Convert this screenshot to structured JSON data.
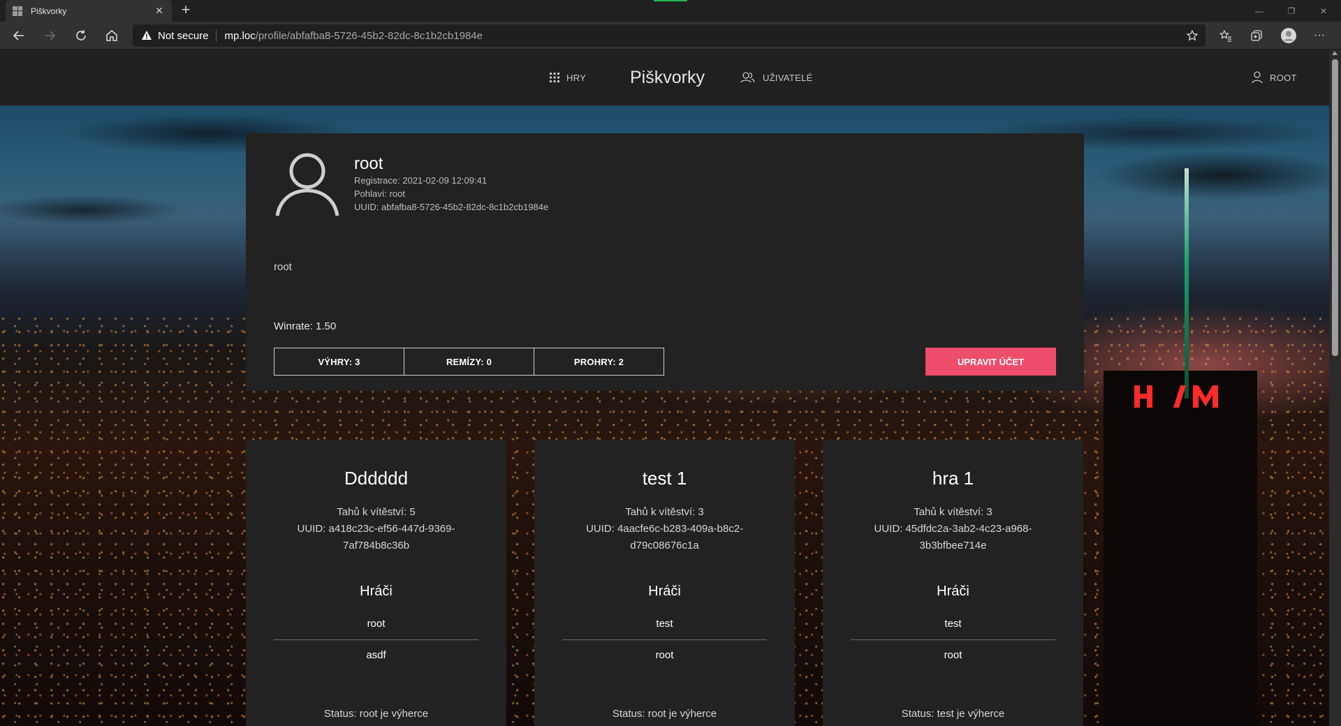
{
  "browser": {
    "tab_title": "Piškvorky",
    "security_label": "Not secure",
    "url_host": "mp.loc",
    "url_path": "/profile/abfafba8-5726-45b2-82dc-8c1b2cb1984e",
    "icons": [
      "back-icon",
      "forward-icon",
      "refresh-icon",
      "home-icon",
      "warning-icon",
      "add-favorite-icon",
      "favorites-icon",
      "collections-icon",
      "profile-icon",
      "more-icon"
    ]
  },
  "nav": {
    "games_label": "HRY",
    "brand": "Piškvorky",
    "users_label": "UŽIVATELÉ",
    "account_label": "ROOT"
  },
  "profile": {
    "name": "root",
    "registered": "Registrace: 2021-02-09 12:09:41",
    "gender": "Pohlaví: root",
    "uuid": "UUID: abfafba8-5726-45b2-82dc-8c1b2cb1984e",
    "bio": "root",
    "winrate": "Winrate: 1.50",
    "wins": "VÝHRY: 3",
    "draws": "REMÍZY: 0",
    "losses": "PROHRY: 2",
    "edit_button": "UPRAVIT ÚČET"
  },
  "games": [
    {
      "title": "Dddddd",
      "moves": "Tahů k vítěství: 5",
      "uuid_line1": "UUID: a418c23c-ef56-447d-9369-",
      "uuid_line2": "7af784b8c36b",
      "players_heading": "Hráči",
      "player1": "root",
      "player2": "asdf",
      "status": "Status: root je výherce"
    },
    {
      "title": "test 1",
      "moves": "Tahů k vítěství: 3",
      "uuid_line1": "UUID: 4aacfe6c-b283-409a-b8c2-",
      "uuid_line2": "d79c08676c1a",
      "players_heading": "Hráči",
      "player1": "test",
      "player2": "root",
      "status": "Status: root je výherce"
    },
    {
      "title": "hra 1",
      "moves": "Tahů k vítěství: 3",
      "uuid_line1": "UUID: 45dfdc2a-3ab2-4c23-a968-",
      "uuid_line2": "3b3bfbee714e",
      "players_heading": "Hráči",
      "player1": "test",
      "player2": "root",
      "status": "Status: test je výherce"
    }
  ],
  "colors": {
    "accent": "#ee4d6c",
    "card_bg": "#222222",
    "header_bg": "#202020"
  }
}
